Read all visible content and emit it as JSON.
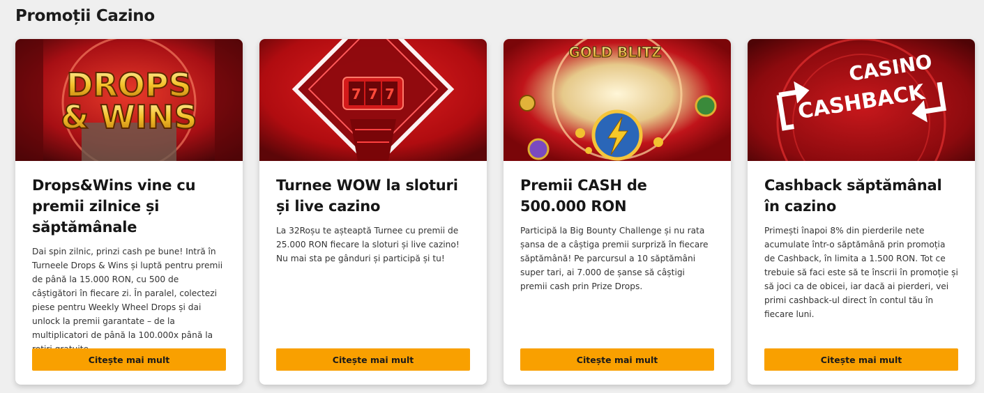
{
  "section": {
    "title": "Promoții Cazino"
  },
  "cards": [
    {
      "banner_lines": [
        "DROPS",
        "& WINS"
      ],
      "title": "Drops&Wins vine cu premii zilnice și săptămânale",
      "text": "Dai spin zilnic, prinzi cash pe bune! Intră în Turneele Drops & Wins și luptă pentru premii de până la 15.000 RON, cu 500 de câștigători în fiecare zi. În paralel, colectezi piese pentru Weekly Wheel Drops și dai unlock la premii garantate – de la multiplicatori de până la 100.000x până la rotiri gratuite.",
      "cta": "Citește mai mult"
    },
    {
      "banner_slot": [
        "7",
        "7",
        "7"
      ],
      "title": "Turnee WOW la sloturi și live cazino",
      "text": "La 32Roșu te așteaptă Turnee cu premii de 25.000 RON fiecare la sloturi și live cazino! Nu mai sta pe gânduri și participă și tu!",
      "cta": "Citește mai mult"
    },
    {
      "banner_logo": "GOLD BLITZ",
      "title": "Premii CASH de 500.000 RON",
      "text": "Participă la Big Bounty Challenge și nu rata șansa de a câștiga premii surpriză în fiecare săptămână! Pe parcursul a 10 săptămâni super tari, ai 7.000 de șanse să câștigi premii cash prin Prize Drops.",
      "cta": "Citește mai mult"
    },
    {
      "banner_lines": [
        "CASINO",
        "CASHBACK"
      ],
      "title": "Cashback săptămânal în cazino",
      "text": "Primești înapoi 8% din pierderile nete acumulate într-o săptămână prin promoția de Cashback, în limita a 1.500 RON. Tot ce trebuie să faci este să te înscrii în promoție și să joci ca de obicei, iar dacă ai pierderi, vei primi cashback-ul direct în contul tău în fiecare luni.",
      "cta": "Citește mai mult"
    }
  ]
}
